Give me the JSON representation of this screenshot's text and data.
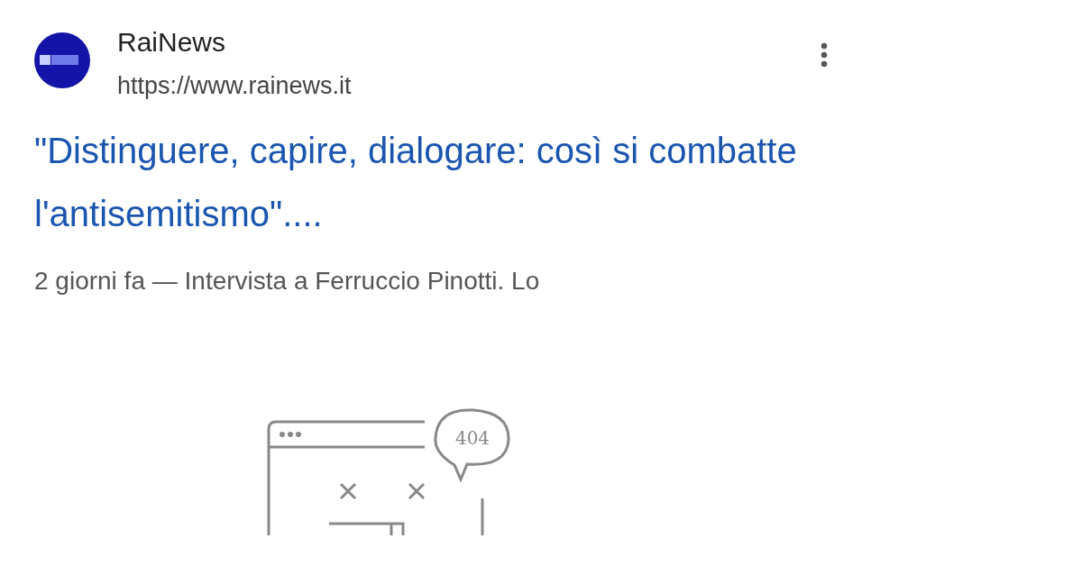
{
  "result": {
    "source_name": "RaiNews",
    "url": "https://www.rainews.it",
    "headline": "\"Distinguere, capire, dialogare: così si combatte l'antisemitismo\"....",
    "snippet": "2 giorni fa — Intervista a Ferruccio Pinotti. Lo"
  },
  "error_illustration": {
    "label": "404"
  }
}
